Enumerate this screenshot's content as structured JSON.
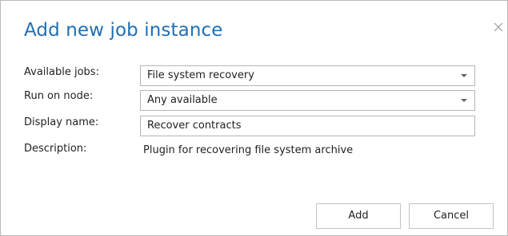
{
  "dialog": {
    "title": "Add new job instance",
    "close_icon": "close-icon"
  },
  "form": {
    "available_jobs": {
      "label": "Available jobs:",
      "value": "File system recovery"
    },
    "run_on_node": {
      "label": "Run on node:",
      "value": "Any available"
    },
    "display_name": {
      "label": "Display name:",
      "value": "Recover contracts"
    },
    "description": {
      "label": "Description:",
      "value": "Plugin for recovering file system archive"
    }
  },
  "buttons": {
    "add_label": "Add",
    "cancel_label": "Cancel"
  },
  "colors": {
    "title": "#1f6fb5",
    "border": "#b5b5b5"
  }
}
